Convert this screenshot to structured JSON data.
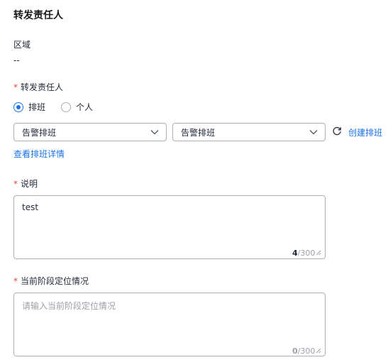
{
  "form": {
    "title": "转发责任人",
    "region": {
      "label": "区域",
      "value": "--"
    },
    "assignee": {
      "required_mark": "*",
      "label": "转发责任人",
      "options": [
        {
          "label": "排班",
          "checked": true
        },
        {
          "label": "个人",
          "checked": false
        }
      ],
      "select1": "告警排班",
      "select2": "告警排班",
      "create_link": "创建排班",
      "view_link": "查看排班详情"
    },
    "description": {
      "required_mark": "*",
      "label": "说明",
      "value": "test",
      "count": "4",
      "max": "/300"
    },
    "status": {
      "required_mark": "*",
      "label": "当前阶段定位情况",
      "placeholder": "请输入当前阶段定位情况",
      "count": "0",
      "max": "/300"
    }
  },
  "icons": {
    "select_arrow": "chevron-down-icon",
    "refresh": "refresh-icon",
    "resize": "resize-handle-icon"
  },
  "colors": {
    "accent": "#1a73e8",
    "required": "#e54545",
    "border": "#adb0b8",
    "placeholder": "#9c9fa6"
  }
}
